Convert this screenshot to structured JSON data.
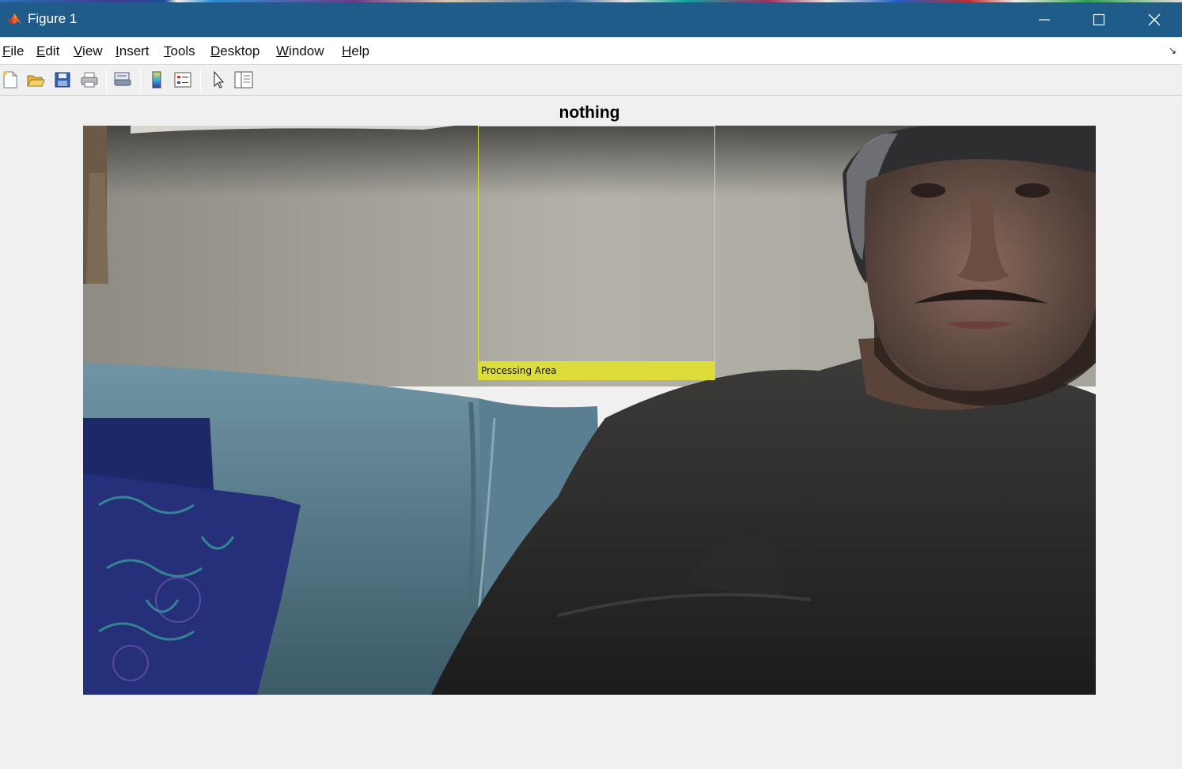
{
  "window": {
    "title": "Figure 1"
  },
  "menu": {
    "items": [
      {
        "accel": "F",
        "rest": "ile"
      },
      {
        "accel": "E",
        "rest": "dit"
      },
      {
        "accel": "V",
        "rest": "iew"
      },
      {
        "accel": "I",
        "rest": "nsert"
      },
      {
        "accel": "T",
        "rest": "ools"
      },
      {
        "accel": "D",
        "rest": "esktop"
      },
      {
        "accel": "W",
        "rest": "indow"
      },
      {
        "accel": "H",
        "rest": "elp"
      }
    ]
  },
  "toolbar": {
    "icons": [
      "new-figure-icon",
      "open-file-icon",
      "save-icon",
      "print-icon",
      "print-preview-icon",
      "colorbar-icon",
      "legend-icon",
      "pointer-icon",
      "property-inspector-icon"
    ]
  },
  "figure": {
    "title": "nothing",
    "roi_label": "Processing Area",
    "roi_color": "#e3e033"
  },
  "colors": {
    "titlebar": "#1f5c8a",
    "menubar": "#ffffff",
    "figure_bg": "#f0f0f0"
  }
}
